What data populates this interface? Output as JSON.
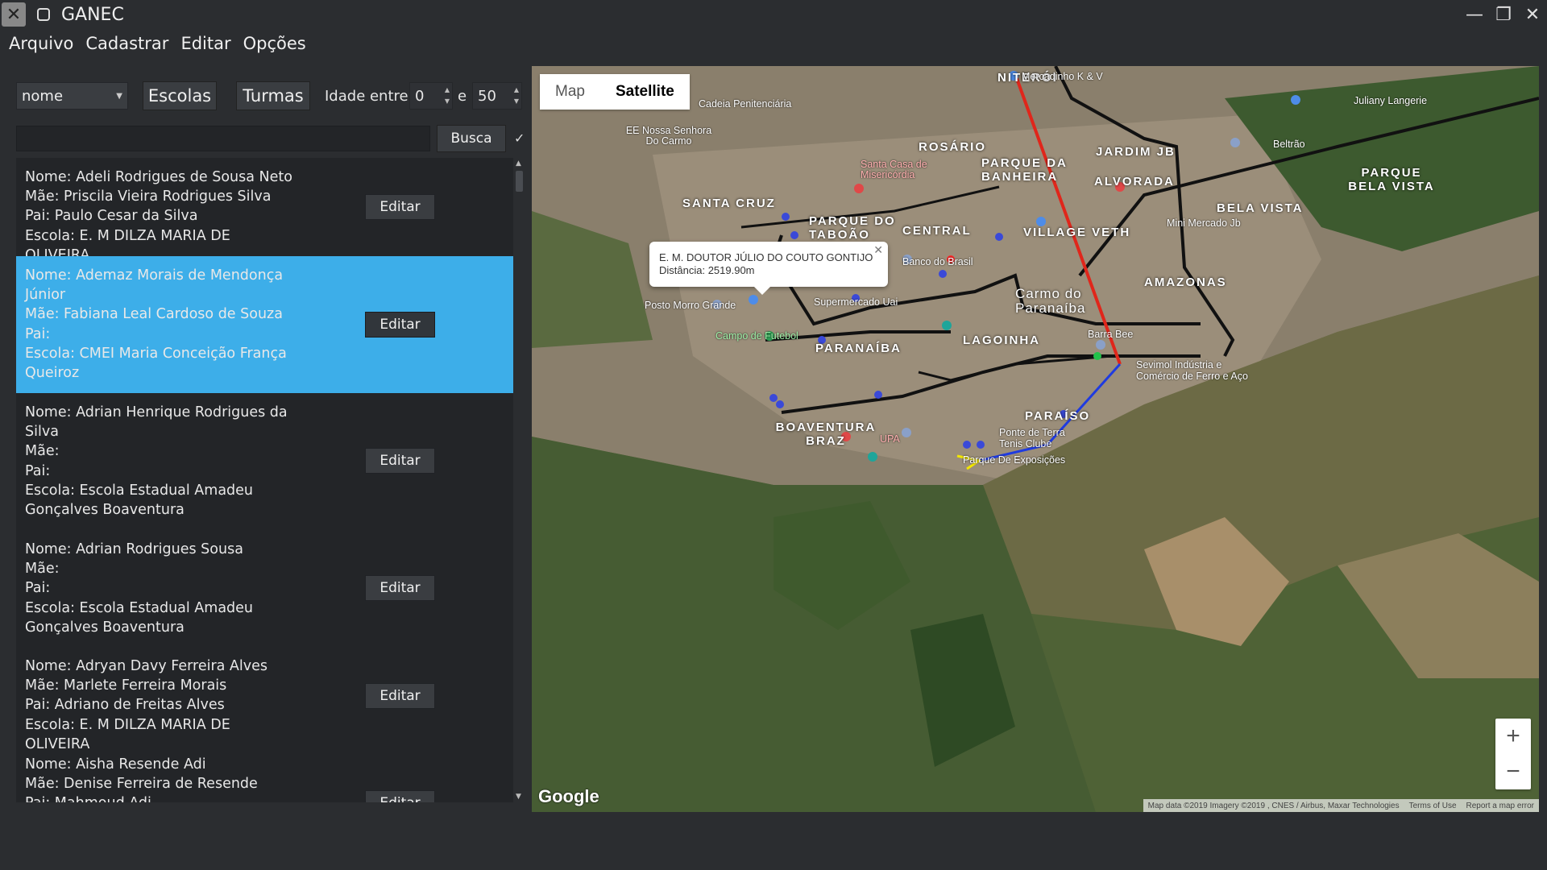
{
  "window": {
    "title": "GANEC"
  },
  "menu": [
    "Arquivo",
    "Cadastrar",
    "Editar",
    "Opções"
  ],
  "filters": {
    "sort_field": "nome",
    "escolas_label": "Escolas",
    "turmas_label": "Turmas",
    "idade_label": "Idade entre",
    "idade_min": "0",
    "e_label": "e",
    "idade_max": "50",
    "search_value": "",
    "search_button": "Busca",
    "check_mark": "✓"
  },
  "students": [
    {
      "lines": [
        "Nome: Adeli Rodrigues de Sousa Neto",
        "Mãe: Priscila Vieira Rodrigues Silva",
        "Pai: Paulo Cesar da Silva",
        "Escola: E. M DILZA MARIA  DE OLIVEIRA"
      ],
      "edit": "Editar",
      "selected": false
    },
    {
      "lines": [
        "Nome: Ademaz Morais de Mendonça",
        "Júnior",
        "Mãe: Fabiana Leal Cardoso de Souza",
        "Pai:",
        "Escola: CMEI Maria Conceição França",
        "Queiroz"
      ],
      "edit": "Editar",
      "selected": true
    },
    {
      "lines": [
        "Nome: Adrian Henrique Rodrigues da",
        "Silva",
        "Mãe:",
        "Pai:",
        "Escola: Escola Estadual Amadeu",
        "Gonçalves Boaventura"
      ],
      "edit": "Editar",
      "selected": false
    },
    {
      "lines": [
        "Nome: Adrian Rodrigues Sousa",
        "Mãe:",
        "Pai:",
        "Escola: Escola Estadual Amadeu",
        "Gonçalves Boaventura"
      ],
      "edit": "Editar",
      "selected": false
    },
    {
      "lines": [
        "Nome: Adryan Davy Ferreira Alves",
        "Mãe: Marlete Ferreira Morais",
        "Pai: Adriano de Freitas Alves",
        "Escola: E. M DILZA MARIA  DE OLIVEIRA"
      ],
      "edit": "Editar",
      "selected": false
    },
    {
      "lines": [
        "Nome: Aisha Resende Adi",
        "Mãe: Denise Ferreira de Resende",
        "Pai: Mahmoud Adi"
      ],
      "edit": "Editar",
      "selected": false
    }
  ],
  "map": {
    "type_map": "Map",
    "type_satellite": "Satellite",
    "infowindow_title": "E. M. DOUTOR JÚLIO DO COUTO GONTIJO",
    "infowindow_distance": "Distância: 2519.90m",
    "zoom_in": "+",
    "zoom_out": "−",
    "google": "Google",
    "attribution": [
      "Map data ©2019 Imagery ©2019 , CNES / Airbus, Maxar Technologies",
      "Terms of Use",
      "Report a map error"
    ],
    "neighborhoods": [
      "NITERÓI",
      "ROSÁRIO",
      "PARQUE DA BANHEIRA",
      "JARDIM JB",
      "ALVORADA",
      "PARQUE BELA VISTA",
      "SANTA CRUZ",
      "PARQUE DO TABOÃO",
      "CENTRAL",
      "VILLAGE VETH",
      "BELA VISTA",
      "AMAZONAS",
      "Carmo do Paranaíba",
      "PARANAÍBA",
      "LAGOINHA",
      "PARAÍSO",
      "BOAVENTURA BRAZ"
    ],
    "places": [
      "Mercadinho K & V",
      "Cadeia Penitenciária",
      "Juliany Langerie",
      "EE Nossa Senhora Do Carmo",
      "Santa Casa de Misericórdia",
      "Beltrão",
      "Mini Mercado Jb",
      "Banco do Brasil",
      "Posto Morro Grande",
      "Supermercado Uai",
      "Campo de Futebol",
      "Barra Bee",
      "Sevimol Indústria e Comércio de Ferro e Aço",
      "Ponte de Terra Tenis Clube",
      "Parque De Exposições",
      "UPA"
    ]
  }
}
